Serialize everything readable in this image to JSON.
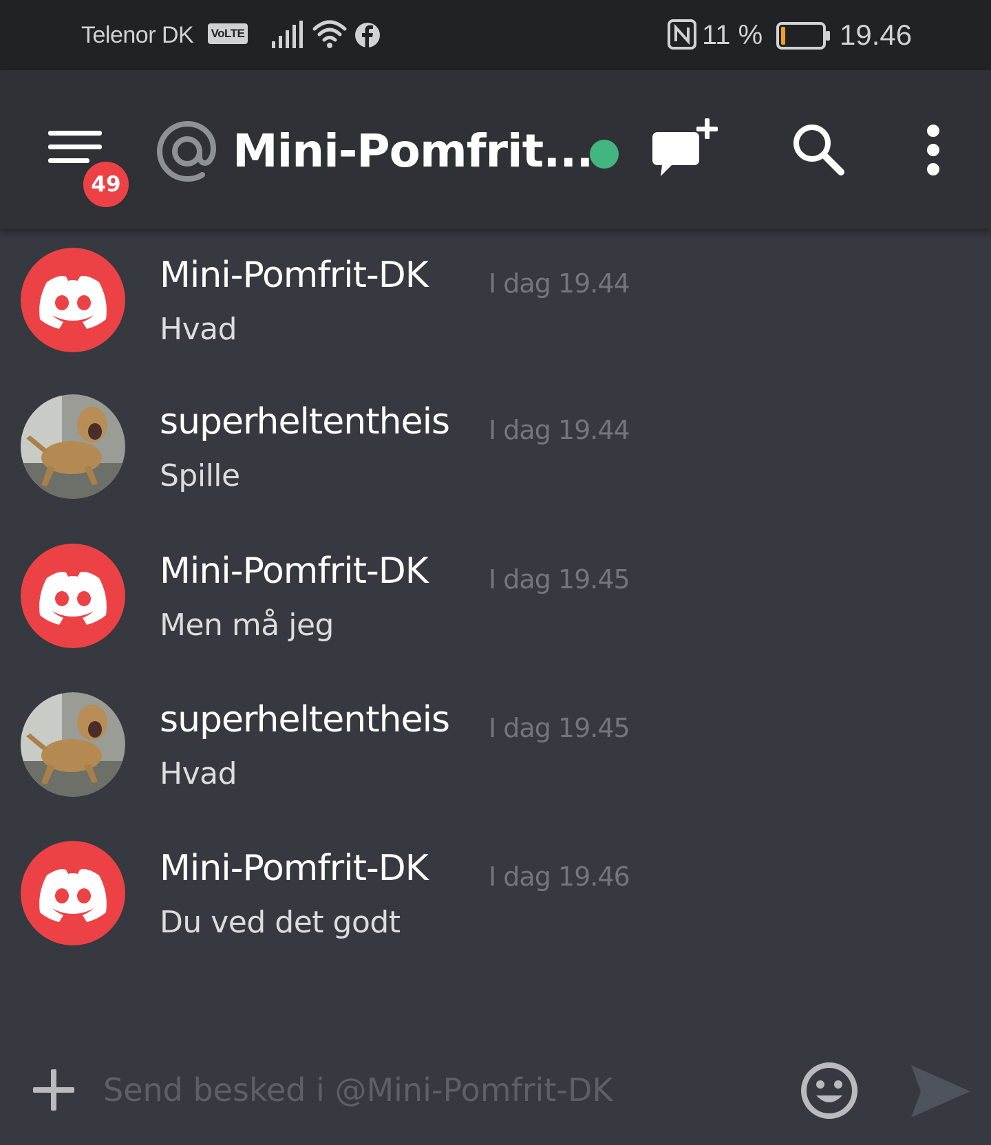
{
  "status_bar": {
    "carrier": "Telenor DK",
    "volte_label": "VoLTE",
    "battery_percent": "11 %",
    "battery_level": 0.11,
    "time": "19.46",
    "icons": [
      "signal-icon",
      "wifi-icon",
      "facebook-icon",
      "nfc-icon",
      "battery-icon"
    ]
  },
  "header": {
    "menu_icon": "hamburger-menu-icon",
    "unread_badge": "49",
    "mention_icon": "at-icon",
    "title": "Mini-Pomfrit...",
    "status": "online",
    "status_color": "#43b581",
    "actions": [
      "new-group-dm-icon",
      "search-icon",
      "more-vertical-icon"
    ]
  },
  "messages": [
    {
      "author": "Mini-Pomfrit-DK",
      "timestamp": "I dag 19.44",
      "text": "Hvad",
      "avatar": "discord-default-avatar"
    },
    {
      "author": "superheltentheis",
      "timestamp": "I dag 19.44",
      "text": "Spille",
      "avatar": "dog-photo-avatar"
    },
    {
      "author": "Mini-Pomfrit-DK",
      "timestamp": "I dag 19.45",
      "text": "Men må jeg",
      "avatar": "discord-default-avatar"
    },
    {
      "author": "superheltentheis",
      "timestamp": "I dag 19.45",
      "text": "Hvad",
      "avatar": "dog-photo-avatar"
    },
    {
      "author": "Mini-Pomfrit-DK",
      "timestamp": "I dag 19.46",
      "text": "Du ved det godt",
      "avatar": "discord-default-avatar"
    }
  ],
  "composer": {
    "add_icon": "plus-icon",
    "placeholder": "Send besked i @Mini-Pomfrit-DK",
    "value": "",
    "emoji_icon": "emoji-smile-icon",
    "send_icon": "send-icon"
  },
  "colors": {
    "background": "#36393f",
    "header": "#2f3136",
    "status_bar": "#202225",
    "badge": "#ed4245",
    "discord_avatar": "#ed4245",
    "timestamp": "#72767d"
  }
}
